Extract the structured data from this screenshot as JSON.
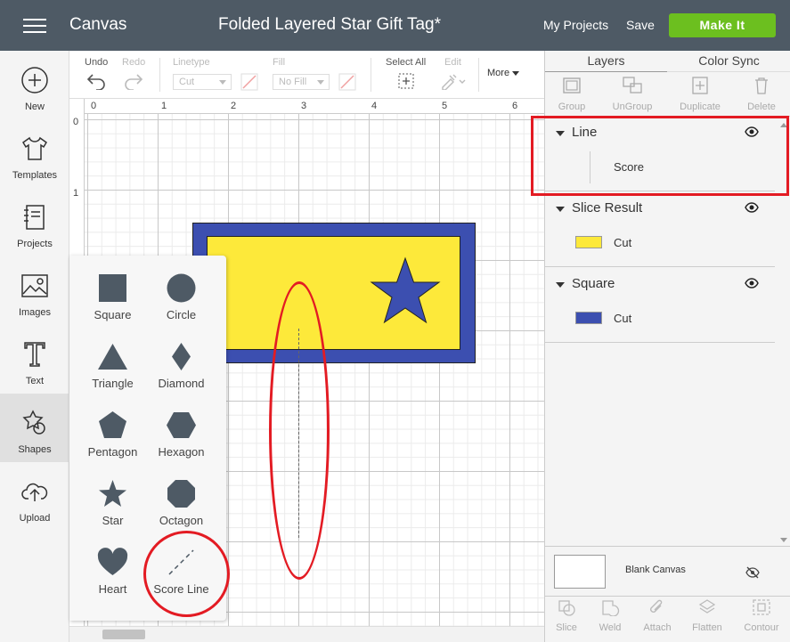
{
  "header": {
    "app": "Canvas",
    "title": "Folded Layered Star Gift Tag*",
    "my_projects": "My Projects",
    "save": "Save",
    "make_it": "Make It"
  },
  "nav": [
    "New",
    "Templates",
    "Projects",
    "Images",
    "Text",
    "Shapes",
    "Upload"
  ],
  "toolbar": {
    "undo": "Undo",
    "redo": "Redo",
    "linetype": "Linetype",
    "linetype_value": "Cut",
    "fill": "Fill",
    "fill_value": "No Fill",
    "select_all": "Select All",
    "edit": "Edit",
    "more": "More"
  },
  "ruler": {
    "h": [
      "0",
      "1",
      "2",
      "3",
      "4",
      "5",
      "6"
    ],
    "v": [
      "0",
      "1"
    ]
  },
  "shapes": [
    "Square",
    "Circle",
    "Triangle",
    "Diamond",
    "Pentagon",
    "Hexagon",
    "Star",
    "Octagon",
    "Heart",
    "Score Line"
  ],
  "panel": {
    "tabs": [
      "Layers",
      "Color Sync"
    ],
    "actions": [
      "Group",
      "UnGroup",
      "Duplicate",
      "Delete"
    ],
    "layers": [
      {
        "name": "Line",
        "sub": "Score"
      },
      {
        "name": "Slice Result",
        "sub": "Cut",
        "color": "#fde93a"
      },
      {
        "name": "Square",
        "sub": "Cut",
        "color": "#3c4fb0"
      }
    ],
    "blank_canvas": "Blank Canvas",
    "bottom_actions": [
      "Slice",
      "Weld",
      "Attach",
      "Flatten",
      "Contour"
    ]
  },
  "colors": {
    "header": "#4e5a65",
    "make_it": "#6cbf1f",
    "highlight": "#e31b23",
    "tag_blue": "#3c4fb0",
    "tag_yellow": "#fde93a"
  }
}
